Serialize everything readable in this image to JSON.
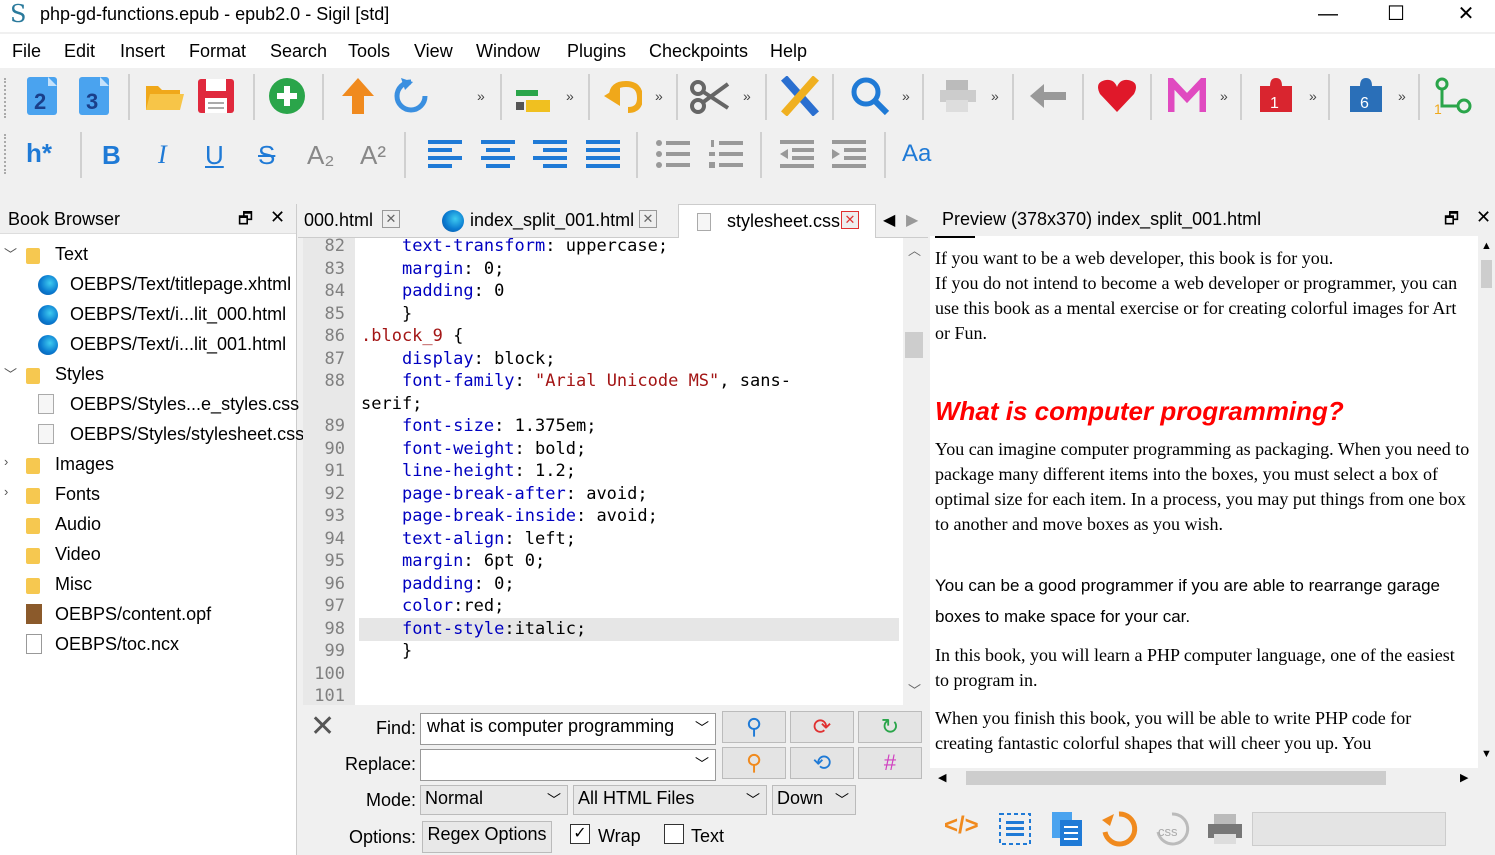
{
  "window": {
    "title": "php-gd-functions.epub - epub2.0 - Sigil [std]",
    "app_icon": "S",
    "minimize": "—",
    "maximize": "☐",
    "close": "✕"
  },
  "menu": [
    "File",
    "Edit",
    "Insert",
    "Format",
    "Search",
    "Tools",
    "View",
    "Window",
    "Plugins",
    "Checkpoints",
    "Help"
  ],
  "toolbar2": {
    "heading": "h*",
    "bold": "B",
    "italic": "I",
    "underline": "U",
    "strike": "S",
    "sub": "A₂",
    "sup": "A²",
    "case": "Aa"
  },
  "book_browser": {
    "title": "Book Browser",
    "items": [
      {
        "label": "Text",
        "type": "folder",
        "expanded": true
      },
      {
        "label": "OEBPS/Text/titlepage.xhtml",
        "type": "html"
      },
      {
        "label": "OEBPS/Text/i...lit_000.html",
        "type": "html"
      },
      {
        "label": "OEBPS/Text/i...lit_001.html",
        "type": "html"
      },
      {
        "label": "Styles",
        "type": "folder",
        "expanded": true
      },
      {
        "label": "OEBPS/Styles...e_styles.css",
        "type": "css"
      },
      {
        "label": "OEBPS/Styles/stylesheet.css",
        "type": "css"
      },
      {
        "label": "Images",
        "type": "folder"
      },
      {
        "label": "Fonts",
        "type": "folder"
      },
      {
        "label": "Audio",
        "type": "folder"
      },
      {
        "label": "Video",
        "type": "folder"
      },
      {
        "label": "Misc",
        "type": "folder"
      },
      {
        "label": "OEBPS/content.opf",
        "type": "opf"
      },
      {
        "label": "OEBPS/toc.ncx",
        "type": "ncx"
      }
    ]
  },
  "tabs": [
    "000.html",
    "index_split_001.html",
    "stylesheet.css"
  ],
  "editor": {
    "lines": [
      {
        "n": "82",
        "t": "    text-transform: uppercase;"
      },
      {
        "n": "83",
        "t": "    margin: 0;"
      },
      {
        "n": "84",
        "t": "    padding: 0"
      },
      {
        "n": "85",
        "t": "    }"
      },
      {
        "n": "86",
        "t": ".block_9 {"
      },
      {
        "n": "87",
        "t": "    display: block;"
      },
      {
        "n": "88",
        "t": "    font-family: \"Arial Unicode MS\", sans-"
      },
      {
        "n": "",
        "t": "serif;"
      },
      {
        "n": "89",
        "t": "    font-size: 1.375em;"
      },
      {
        "n": "90",
        "t": "    font-weight: bold;"
      },
      {
        "n": "91",
        "t": "    line-height: 1.2;"
      },
      {
        "n": "92",
        "t": "    page-break-after: avoid;"
      },
      {
        "n": "93",
        "t": "    page-break-inside: avoid;"
      },
      {
        "n": "94",
        "t": "    text-align: left;"
      },
      {
        "n": "95",
        "t": "    margin: 6pt 0;"
      },
      {
        "n": "96",
        "t": "    padding: 0;"
      },
      {
        "n": "97",
        "t": "    color:red;"
      },
      {
        "n": "98",
        "t": "    font-style:italic;"
      },
      {
        "n": "99",
        "t": "    }"
      },
      {
        "n": "100",
        "t": ""
      },
      {
        "n": "101",
        "t": ""
      }
    ]
  },
  "find": {
    "find_label": "Find:",
    "find_value": "what is computer programming",
    "replace_label": "Replace:",
    "replace_value": "",
    "mode_label": "Mode:",
    "mode_value": "Normal",
    "scope_value": "All HTML Files",
    "direction_value": "Down",
    "options_label": "Options:",
    "regex_button": "Regex Options",
    "wrap_label": "Wrap",
    "text_label": "Text",
    "wrap_checked": true,
    "text_checked": false
  },
  "preview": {
    "title": "Preview (378x370) index_split_001.html",
    "p1": "If you want to be a web developer, this book is for you.",
    "p2": "If you do not intend to become a web developer or programmer, you can use this book as a mental exercise or for creating colorful images for Art or Fun.",
    "heading": "What is computer programming?",
    "p3": "You can imagine computer programming as packaging. When you need to package many different items into the boxes, you must select a box of optimal size for each item. In a process, you may put things from one box to another and move boxes as you wish.",
    "p4": "You can be a good programmer if you are able to rearrange garage boxes to make space for your car.",
    "p5": "In this book, you will learn a PHP computer language, one of the easiest to program in.",
    "p6": "When you finish this book, you will be able to write PHP code for creating fantastic colorful shapes that will cheer you up. You"
  },
  "bottom_tools": {
    "code": "</>",
    "css": "css"
  }
}
